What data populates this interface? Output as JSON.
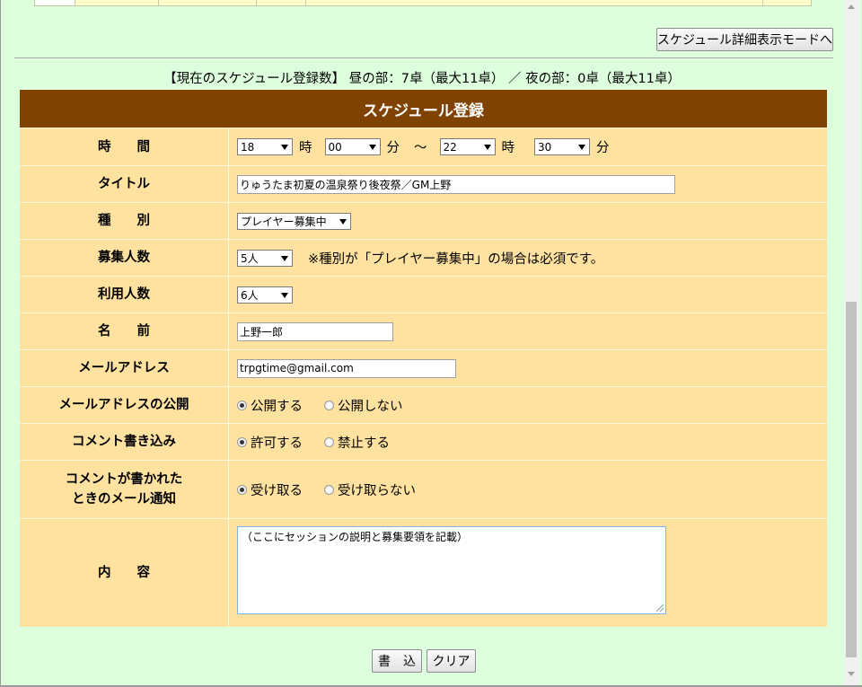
{
  "detail_mode_button": "スケジュール詳細表示モードへ",
  "summary": "【現在のスケジュール登録数】 昼の部：7卓（最大11卓） ／ 夜の部：0卓（最大11卓）",
  "form": {
    "header": "スケジュール登録",
    "time": {
      "label": "時　　間",
      "start_hour": "18",
      "hour_unit": "時",
      "start_min": "00",
      "min_unit": "分",
      "tilde": "～",
      "end_hour": "22",
      "end_min": "30"
    },
    "title": {
      "label": "タイトル",
      "value": "りゅうたま初夏の温泉祭り後夜祭／GM上野"
    },
    "type": {
      "label": "種　　別",
      "value": "プレイヤー募集中"
    },
    "recruit": {
      "label": "募集人数",
      "value": "5人",
      "note": "※種別が「プレイヤー募集中」の場合は必須です。"
    },
    "users": {
      "label": "利用人数",
      "value": "6人"
    },
    "name": {
      "label": "名　　前",
      "value": "上野一郎"
    },
    "email": {
      "label": "メールアドレス",
      "value": "trpgtime@gmail.com"
    },
    "email_public": {
      "label": "メールアドレスの公開",
      "opt1": "公開する",
      "opt2": "公開しない"
    },
    "comment": {
      "label": "コメント書き込み",
      "opt1": "許可する",
      "opt2": "禁止する"
    },
    "notify": {
      "label_line1": "コメントが書かれた",
      "label_line2": "ときのメール通知",
      "opt1": "受け取る",
      "opt2": "受け取らない"
    },
    "content": {
      "label": "内　　容",
      "value": "（ここにセッションの説明と募集要領を記載）"
    }
  },
  "buttons": {
    "submit": "書　込",
    "clear": "クリア"
  }
}
